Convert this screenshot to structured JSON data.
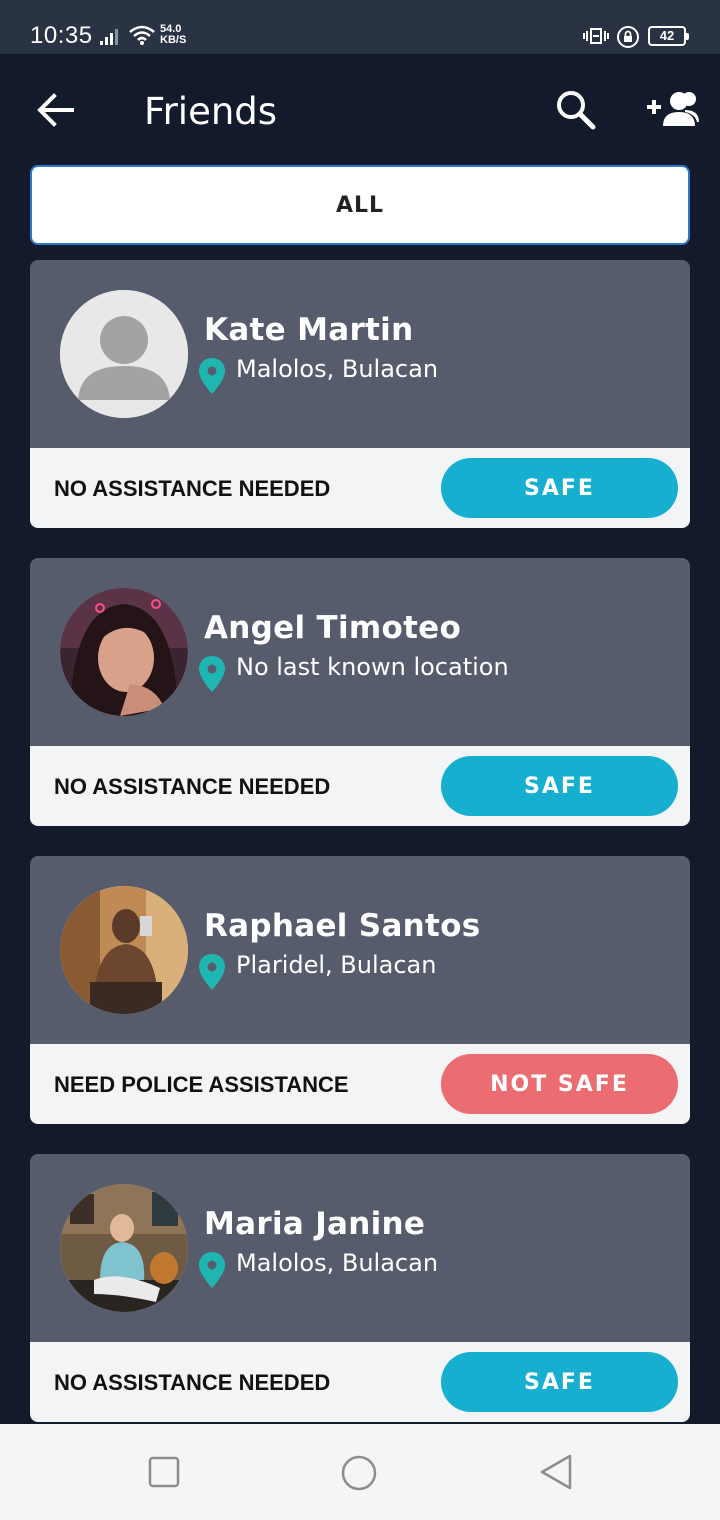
{
  "status_bar": {
    "time": "10:35",
    "speed_value": "54.0",
    "speed_unit": "KB/S",
    "battery": "42"
  },
  "header": {
    "title": "Friends"
  },
  "filter": {
    "label": "ALL"
  },
  "colors": {
    "safe": "#17afd0",
    "not_safe": "#eb6d72",
    "pin": "#1fb5b0"
  },
  "friends": [
    {
      "name": "Kate Martin",
      "location": "Malolos, Bulacan",
      "assistance": "NO ASSISTANCE NEEDED",
      "status": "SAFE"
    },
    {
      "name": "Angel Timoteo",
      "location": "No last known location",
      "assistance": "NO ASSISTANCE NEEDED",
      "status": "SAFE"
    },
    {
      "name": "Raphael Santos",
      "location": "Plaridel, Bulacan",
      "assistance": "NEED POLICE ASSISTANCE",
      "status": "NOT SAFE"
    },
    {
      "name": "Maria Janine",
      "location": "Malolos, Bulacan",
      "assistance": "NO ASSISTANCE NEEDED",
      "status": "SAFE"
    }
  ]
}
